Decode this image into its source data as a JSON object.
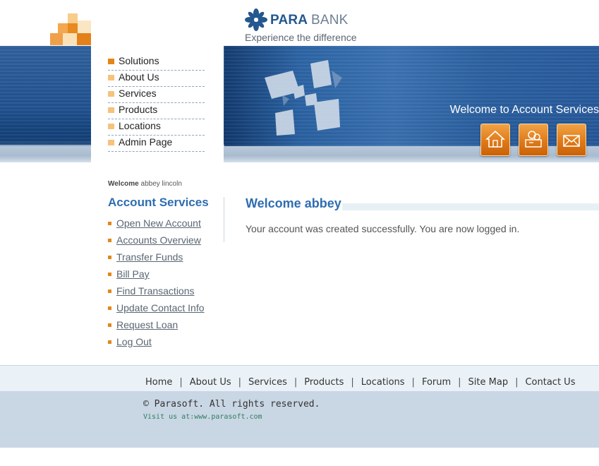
{
  "header": {
    "brand_para": "PARA",
    "brand_bank": "BANK",
    "tagline": "Experience the difference"
  },
  "banner": {
    "welcome_text": "Welcome to Account Services",
    "buttons": [
      {
        "icon": "home-icon"
      },
      {
        "icon": "contact-people-icon"
      },
      {
        "icon": "mail-icon"
      }
    ]
  },
  "top_nav": {
    "items": [
      {
        "label": "Solutions"
      },
      {
        "label": "About Us"
      },
      {
        "label": "Services"
      },
      {
        "label": "Products"
      },
      {
        "label": "Locations"
      },
      {
        "label": "Admin Page"
      }
    ]
  },
  "sidebar": {
    "welcome_label": "Welcome",
    "user_name": "abbey lincoln",
    "title": "Account Services",
    "links": [
      {
        "label": "Open New Account"
      },
      {
        "label": "Accounts Overview"
      },
      {
        "label": "Transfer Funds"
      },
      {
        "label": "Bill Pay"
      },
      {
        "label": "Find Transactions"
      },
      {
        "label": "Update Contact Info"
      },
      {
        "label": "Request Loan"
      },
      {
        "label": "Log Out"
      }
    ]
  },
  "main": {
    "title": "Welcome abbey",
    "message": "Your account was created successfully. You are now logged in."
  },
  "footer": {
    "links": [
      {
        "label": "Home"
      },
      {
        "label": "About Us"
      },
      {
        "label": "Services"
      },
      {
        "label": "Products"
      },
      {
        "label": "Locations"
      },
      {
        "label": "Forum"
      },
      {
        "label": "Site Map"
      },
      {
        "label": "Contact Us"
      }
    ],
    "copyright": "© Parasoft. All rights reserved.",
    "visit": "Visit us at:www.parasoft.com"
  },
  "colors": {
    "accent_orange": "#e3861a",
    "brand_blue": "#2e6db0",
    "banner_blue": "#1f4f8c"
  }
}
